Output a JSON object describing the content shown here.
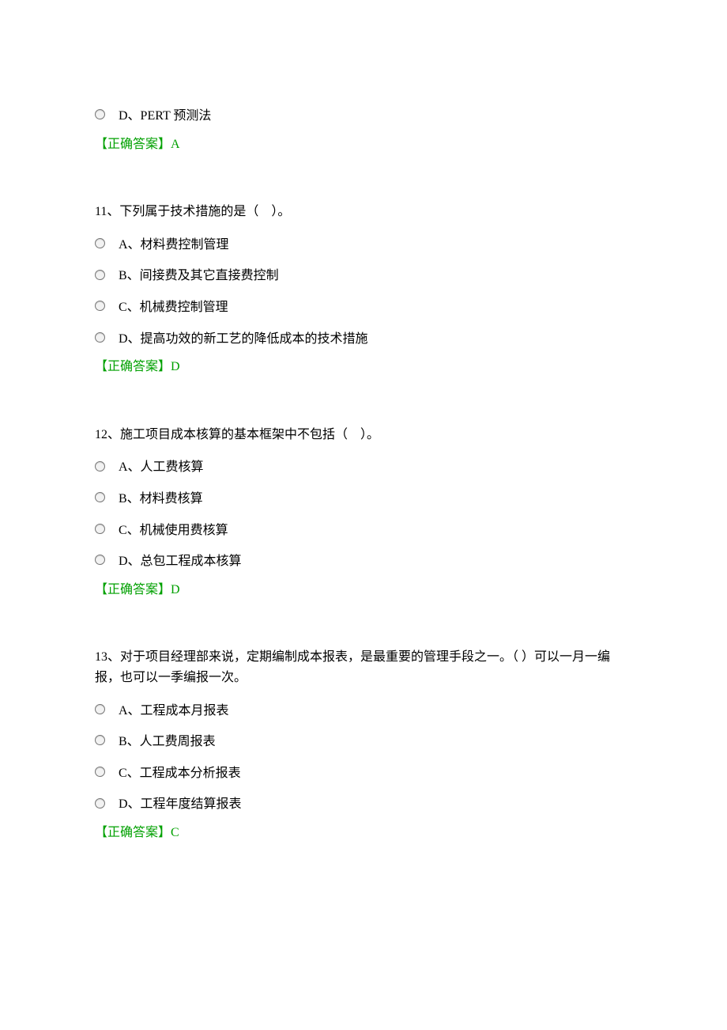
{
  "orphan": {
    "option_d": "D、PERT 预测法",
    "answer": "【正确答案】A"
  },
  "q11": {
    "question": "11、下列属于技术措施的是（　）。",
    "options": {
      "a": "A、材料费控制管理",
      "b": "B、间接费及其它直接费控制",
      "c": "C、机械费控制管理",
      "d": "D、提高功效的新工艺的降低成本的技术措施"
    },
    "answer": "【正确答案】D"
  },
  "q12": {
    "question": "12、施工项目成本核算的基本框架中不包括（　）。",
    "options": {
      "a": "A、人工费核算",
      "b": "B、材料费核算",
      "c": "C、机械使用费核算",
      "d": "D、总包工程成本核算"
    },
    "answer": "【正确答案】D"
  },
  "q13": {
    "question": "13、对于项目经理部来说，定期编制成本报表，是最重要的管理手段之一。（ ）可以一月一编报，也可以一季编报一次。",
    "options": {
      "a": "A、工程成本月报表",
      "b": "B、人工费周报表",
      "c": "C、工程成本分析报表",
      "d": "D、工程年度结算报表"
    },
    "answer": "【正确答案】C"
  }
}
